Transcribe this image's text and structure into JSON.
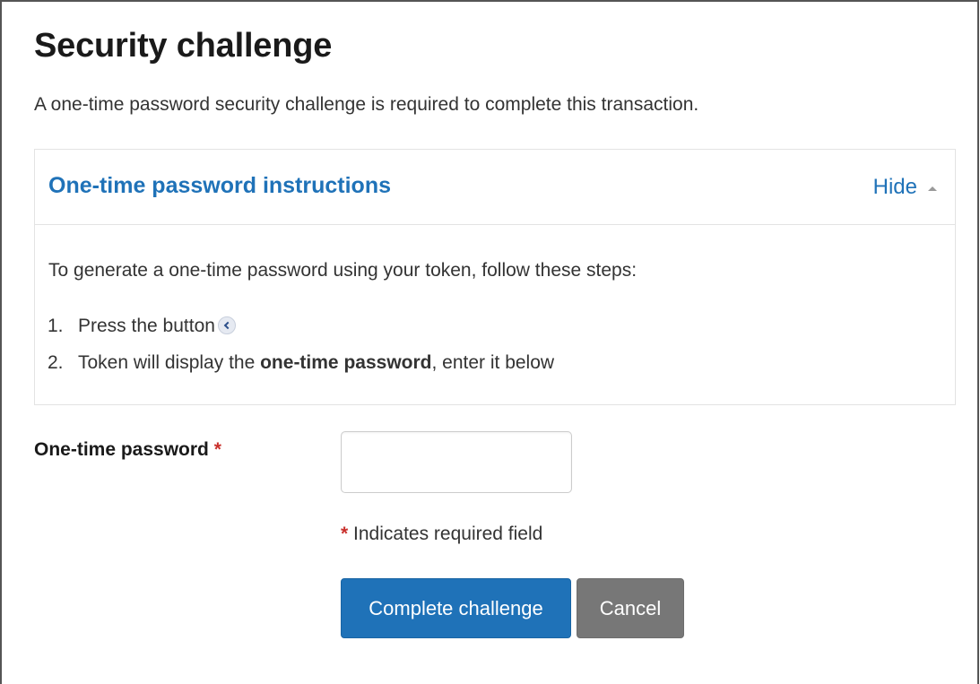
{
  "page": {
    "title": "Security challenge",
    "intro": "A one-time password security challenge is required to complete this transaction."
  },
  "instructions_panel": {
    "title": "One-time password instructions",
    "toggle_label": "Hide",
    "lead": "To generate a one-time password using your token, follow these steps:",
    "steps": [
      {
        "number": "1.",
        "text": "Press the button"
      },
      {
        "number": "2.",
        "text_before": "Token will display the ",
        "text_bold": "one-time password",
        "text_after": ", enter it below"
      }
    ]
  },
  "form": {
    "otp_label": "One-time password",
    "required_marker": "*",
    "otp_value": "",
    "required_note": "Indicates required field"
  },
  "actions": {
    "submit_label": "Complete challenge",
    "cancel_label": "Cancel"
  },
  "colors": {
    "link_blue": "#1f72b8",
    "required_red": "#c9302c",
    "cancel_gray": "#777777"
  },
  "icons": {
    "toggle": "caret-up-icon",
    "token_button": "token-back-button-icon"
  }
}
